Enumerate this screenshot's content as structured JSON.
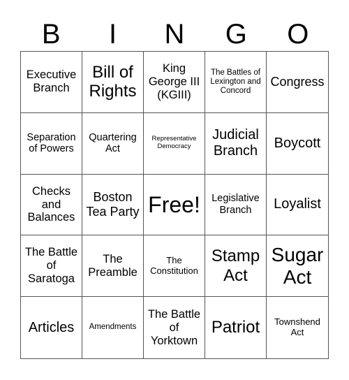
{
  "header": [
    "B",
    "I",
    "N",
    "G",
    "O"
  ],
  "cells": [
    [
      "Executive Branch",
      "Bill of Rights",
      "King George III (KGIII)",
      "The Battles of Lexington and Concord",
      "Congress"
    ],
    [
      "Separation of Powers",
      "Quartering Act",
      "Representative Democracy",
      "Judicial Branch",
      "Boycott"
    ],
    [
      "Checks and Balances",
      "Boston Tea Party",
      "Free!",
      "Legislative Branch",
      "Loyalist"
    ],
    [
      "The Battle of Saratoga",
      "The Preamble",
      "The Constitution",
      "Stamp Act",
      "Sugar Act"
    ],
    [
      "Articles",
      "Amendments",
      "The Battle of Yorktown",
      "Patriot",
      "Townshend Act"
    ]
  ]
}
